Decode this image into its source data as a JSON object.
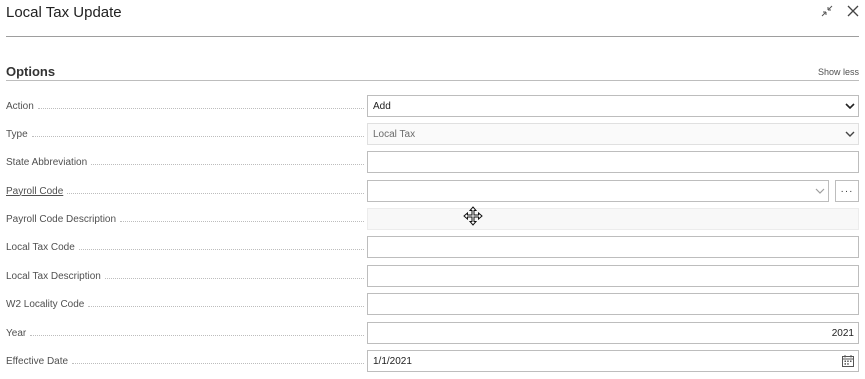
{
  "window": {
    "title": "Local Tax Update"
  },
  "section": {
    "title": "Options",
    "toggle": "Show less"
  },
  "fields": [
    {
      "label": "Action",
      "value": "Add"
    },
    {
      "label": "Type",
      "value": "Local Tax"
    },
    {
      "label": "State Abbreviation",
      "value": ""
    },
    {
      "label": "Payroll Code",
      "value": ""
    },
    {
      "label": "Payroll Code Description",
      "value": ""
    },
    {
      "label": "Local Tax Code",
      "value": ""
    },
    {
      "label": "Local Tax Description",
      "value": ""
    },
    {
      "label": "W2 Locality Code",
      "value": ""
    },
    {
      "label": "Year",
      "value": "2021"
    },
    {
      "label": "Effective Date",
      "value": "1/1/2021"
    }
  ],
  "lookup_button": "···",
  "icons": [
    "collapse-icon",
    "close-icon",
    "chevron-down-icon",
    "calendar-icon",
    "move-cursor-icon"
  ]
}
